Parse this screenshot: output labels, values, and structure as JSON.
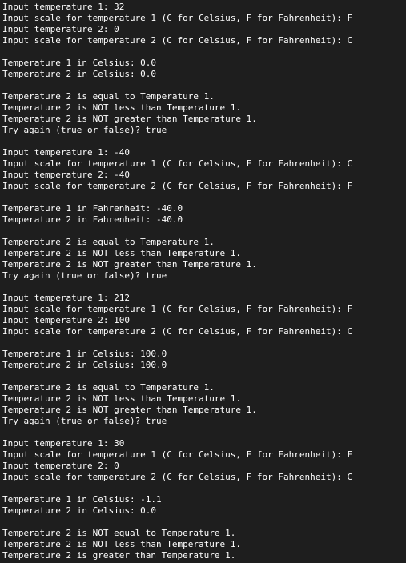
{
  "terminal": {
    "colors": {
      "background": "#1e1e1e",
      "text": "#ffffff"
    },
    "lines": [
      "Input temperature 1: 32",
      "Input scale for temperature 1 (C for Celsius, F for Fahrenheit): F",
      "Input temperature 2: 0",
      "Input scale for temperature 2 (C for Celsius, F for Fahrenheit): C",
      "",
      "Temperature 1 in Celsius: 0.0",
      "Temperature 2 in Celsius: 0.0",
      "",
      "Temperature 2 is equal to Temperature 1.",
      "Temperature 2 is NOT less than Temperature 1.",
      "Temperature 2 is NOT greater than Temperature 1.",
      "Try again (true or false)? true",
      "",
      "Input temperature 1: -40",
      "Input scale for temperature 1 (C for Celsius, F for Fahrenheit): C",
      "Input temperature 2: -40",
      "Input scale for temperature 2 (C for Celsius, F for Fahrenheit): F",
      "",
      "Temperature 1 in Fahrenheit: -40.0",
      "Temperature 2 in Fahrenheit: -40.0",
      "",
      "Temperature 2 is equal to Temperature 1.",
      "Temperature 2 is NOT less than Temperature 1.",
      "Temperature 2 is NOT greater than Temperature 1.",
      "Try again (true or false)? true",
      "",
      "Input temperature 1: 212",
      "Input scale for temperature 1 (C for Celsius, F for Fahrenheit): F",
      "Input temperature 2: 100",
      "Input scale for temperature 2 (C for Celsius, F for Fahrenheit): C",
      "",
      "Temperature 1 in Celsius: 100.0",
      "Temperature 2 in Celsius: 100.0",
      "",
      "Temperature 2 is equal to Temperature 1.",
      "Temperature 2 is NOT less than Temperature 1.",
      "Temperature 2 is NOT greater than Temperature 1.",
      "Try again (true or false)? true",
      "",
      "Input temperature 1: 30",
      "Input scale for temperature 1 (C for Celsius, F for Fahrenheit): F",
      "Input temperature 2: 0",
      "Input scale for temperature 2 (C for Celsius, F for Fahrenheit): C",
      "",
      "Temperature 1 in Celsius: -1.1",
      "Temperature 2 in Celsius: 0.0",
      "",
      "Temperature 2 is NOT equal to Temperature 1.",
      "Temperature 2 is NOT less than Temperature 1.",
      "Temperature 2 is greater than Temperature 1."
    ]
  }
}
